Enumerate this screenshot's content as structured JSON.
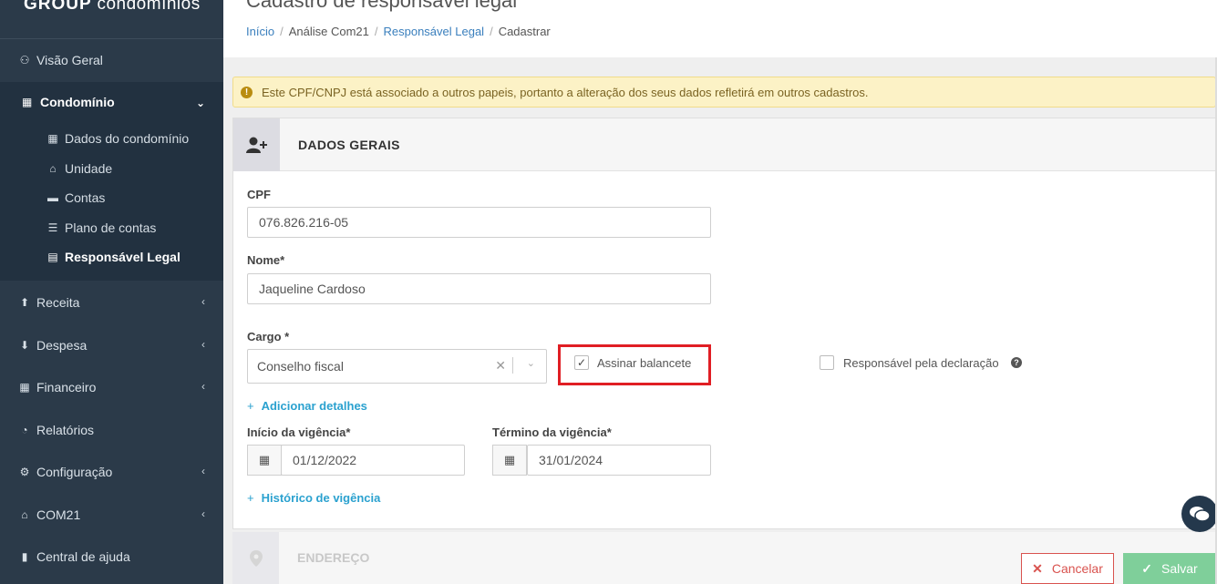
{
  "brand": {
    "bold": "GROUP",
    "light": "condomínios"
  },
  "sidebar": {
    "visao_geral": "Visão Geral",
    "condominio": "Condomínio",
    "sub_items": [
      {
        "label": "Dados do condomínio",
        "icon": "building-icon"
      },
      {
        "label": "Unidade",
        "icon": "home-icon"
      },
      {
        "label": "Contas",
        "icon": "credit-card-icon"
      },
      {
        "label": "Plano de contas",
        "icon": "list-icon"
      },
      {
        "label": "Responsável Legal",
        "icon": "id-card-icon"
      }
    ],
    "receita": "Receita",
    "despesa": "Despesa",
    "financeiro": "Financeiro",
    "relatorios": "Relatórios",
    "configuracao": "Configuração",
    "com21": "COM21",
    "central_ajuda": "Central de ajuda"
  },
  "header": {
    "title": "Cadastro de responsável legal",
    "breadcrumb": [
      "Início",
      "Análise Com21",
      "Responsável Legal",
      "Cadastrar"
    ]
  },
  "alert": {
    "text": "Este CPF/CNPJ está associado a outros papeis, portanto a alteração dos seus dados refletirá em outros cadastros."
  },
  "card": {
    "title": "DADOS GERAIS",
    "cpf_label": "CPF",
    "cpf_value": "076.826.216-05",
    "nome_label": "Nome*",
    "nome_value": "Jaqueline Cardoso",
    "cargo_label": "Cargo *",
    "cargo_value": "Conselho fiscal",
    "assinar_label": "Assinar balancete",
    "assinar_checked": true,
    "responsavel_label": "Responsável pela declaração",
    "responsavel_checked": false,
    "add_detalhes": "Adicionar detalhes",
    "inicio_label": "Início da vigência*",
    "inicio_value": "01/12/2022",
    "termino_label": "Término da vigência*",
    "termino_value": "31/01/2024",
    "historico": "Histórico de vigência"
  },
  "card2": {
    "title": "ENDEREÇO"
  },
  "footer": {
    "cancel": "Cancelar",
    "save": "Salvar"
  },
  "colors": {
    "sidebar": "#2b3a49",
    "link": "#2aa1cf",
    "alert_bg": "#fcf2c6",
    "highlight": "#e01e24",
    "save": "#7fcf9a",
    "cancel": "#d9534f"
  }
}
